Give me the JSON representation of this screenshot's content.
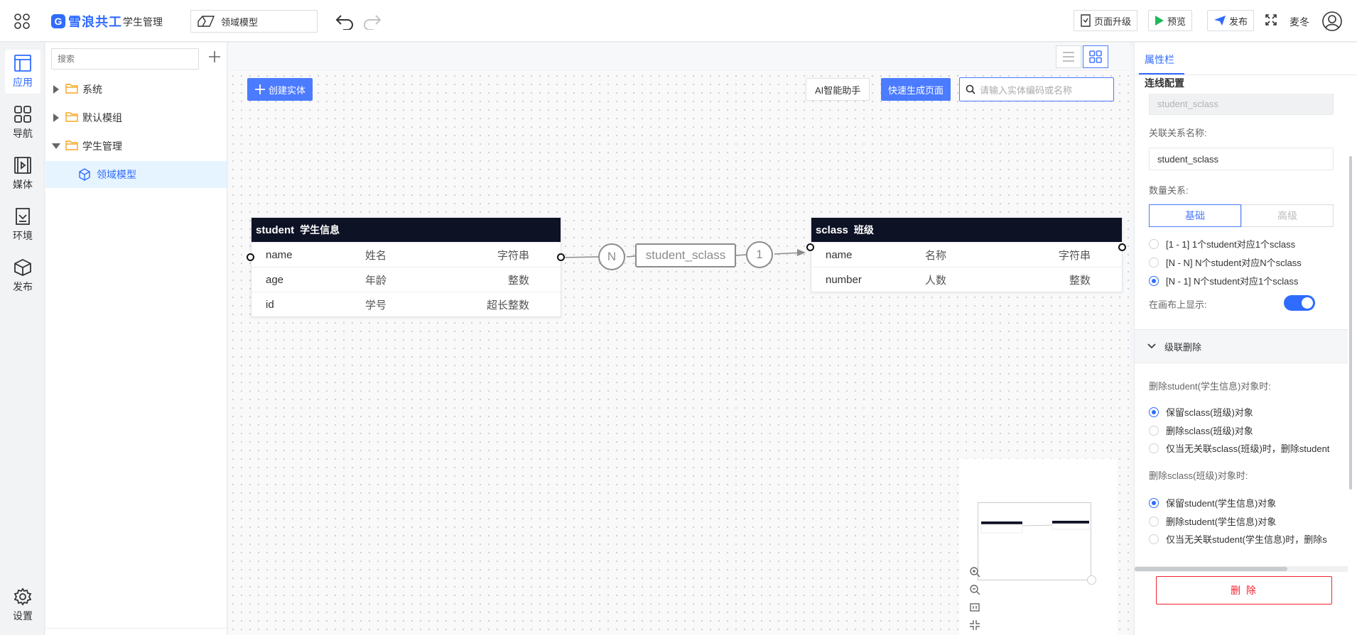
{
  "header": {
    "brand": "雪浪共工",
    "app_name": "学生管理",
    "model_select": "领域模型",
    "upgrade_label": "页面升级",
    "preview_label": "预览",
    "publish_label": "发布",
    "username": "麦冬"
  },
  "rail": [
    {
      "label": "应用",
      "icon": "layout-icon",
      "active": true
    },
    {
      "label": "导航",
      "icon": "apps-icon"
    },
    {
      "label": "媒体",
      "icon": "media-icon"
    },
    {
      "label": "环境",
      "icon": "environment-icon"
    },
    {
      "label": "发布",
      "icon": "cube-icon"
    },
    {
      "label": "设置",
      "icon": "gear-icon"
    }
  ],
  "tree": {
    "search_placeholder": "搜索",
    "items": [
      {
        "label": "系统"
      },
      {
        "label": "默认模组"
      },
      {
        "label": "学生管理"
      },
      {
        "label": "领域模型"
      }
    ]
  },
  "canvas": {
    "create_label": "创建实体",
    "ai_label": "AI智能助手",
    "quick_label": "快速生成页面",
    "search_placeholder": "请输入实体编码或名称"
  },
  "entities": [
    {
      "code": "student",
      "name": "学生信息",
      "fields": [
        {
          "name": "name",
          "label": "姓名",
          "type": "字符串"
        },
        {
          "name": "age",
          "label": "年龄",
          "type": "整数"
        },
        {
          "name": "id",
          "label": "学号",
          "type": "超长整数"
        }
      ]
    },
    {
      "code": "sclass",
      "name": "班级",
      "fields": [
        {
          "name": "name",
          "label": "名称",
          "type": "字符串"
        },
        {
          "name": "number",
          "label": "人数",
          "type": "整数"
        }
      ]
    }
  ],
  "relation": {
    "label": "student_sclass",
    "source_card": "N",
    "target_card": "1"
  },
  "panel": {
    "tab": "属性栏",
    "section": "连线配置",
    "code_value": "student_sclass",
    "name_label": "关联关系名称:",
    "name_value": "student_sclass",
    "quantity_label": "数量关系:",
    "seg_basic": "基础",
    "seg_advanced": "高级",
    "quantity_options": [
      {
        "label": "[1 - 1] 1个student对应1个sclass",
        "checked": false
      },
      {
        "label": "[N - N] N个student对应N个sclass",
        "checked": false
      },
      {
        "label": "[N - 1] N个student对应1个sclass",
        "checked": true
      }
    ],
    "show_on_canvas_label": "在画布上显示:",
    "show_on_canvas": true,
    "cascade_title": "级联删除",
    "student_delete_label": "删除student(学生信息)对象时:",
    "student_delete_options": [
      {
        "label": "保留sclass(班级)对象",
        "checked": true
      },
      {
        "label": "删除sclass(班级)对象",
        "checked": false
      },
      {
        "label": "仅当无关联sclass(班级)时，删除student",
        "checked": false
      }
    ],
    "sclass_delete_label": "删除sclass(班级)对象时:",
    "sclass_delete_options": [
      {
        "label": "保留student(学生信息)对象",
        "checked": true
      },
      {
        "label": "删除student(学生信息)对象",
        "checked": false
      },
      {
        "label": "仅当无关联student(学生信息)时，删除s",
        "checked": false
      }
    ],
    "delete_label": "删 除"
  }
}
